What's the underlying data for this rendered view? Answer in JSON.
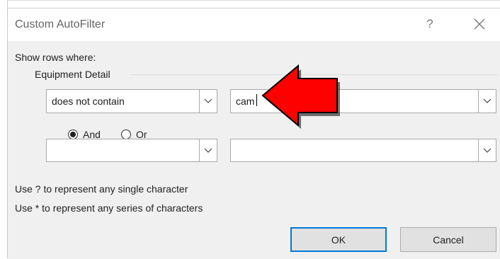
{
  "dialog": {
    "title": "Custom AutoFilter",
    "help_glyph": "?",
    "close_glyph": "✕",
    "show_rows_label": "Show rows where:",
    "field_label": "Equipment Detail",
    "condition1": {
      "operator": "does not contain",
      "value": "cam"
    },
    "logic": {
      "and_label": "And",
      "or_label": "Or",
      "selected": "And"
    },
    "condition2": {
      "operator": "",
      "value": ""
    },
    "hint1": "Use ? to represent any single character",
    "hint2": "Use * to represent any series of characters",
    "ok_label": "OK",
    "cancel_label": "Cancel"
  },
  "annotation": {
    "arrow_color": "#ff0000",
    "arrow_direction": "left",
    "icon": "callout-arrow-icon"
  },
  "colors": {
    "default_button_border": "#0078d7",
    "dialog_bg": "#f0f0f0"
  }
}
